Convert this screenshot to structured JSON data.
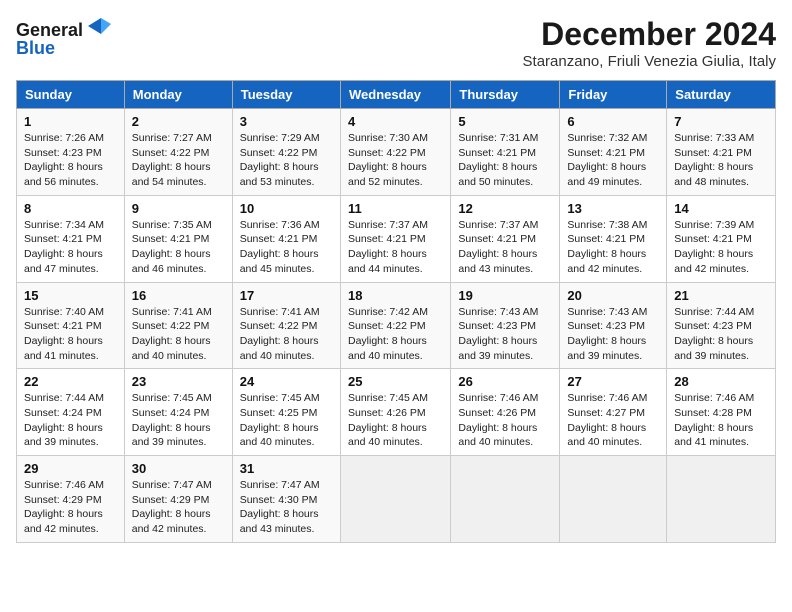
{
  "header": {
    "logo_line1": "General",
    "logo_line2": "Blue",
    "month_title": "December 2024",
    "subtitle": "Staranzano, Friuli Venezia Giulia, Italy"
  },
  "weekdays": [
    "Sunday",
    "Monday",
    "Tuesday",
    "Wednesday",
    "Thursday",
    "Friday",
    "Saturday"
  ],
  "weeks": [
    [
      {
        "day": "1",
        "sunrise": "7:26 AM",
        "sunset": "4:23 PM",
        "daylight": "8 hours and 56 minutes."
      },
      {
        "day": "2",
        "sunrise": "7:27 AM",
        "sunset": "4:22 PM",
        "daylight": "8 hours and 54 minutes."
      },
      {
        "day": "3",
        "sunrise": "7:29 AM",
        "sunset": "4:22 PM",
        "daylight": "8 hours and 53 minutes."
      },
      {
        "day": "4",
        "sunrise": "7:30 AM",
        "sunset": "4:22 PM",
        "daylight": "8 hours and 52 minutes."
      },
      {
        "day": "5",
        "sunrise": "7:31 AM",
        "sunset": "4:21 PM",
        "daylight": "8 hours and 50 minutes."
      },
      {
        "day": "6",
        "sunrise": "7:32 AM",
        "sunset": "4:21 PM",
        "daylight": "8 hours and 49 minutes."
      },
      {
        "day": "7",
        "sunrise": "7:33 AM",
        "sunset": "4:21 PM",
        "daylight": "8 hours and 48 minutes."
      }
    ],
    [
      {
        "day": "8",
        "sunrise": "7:34 AM",
        "sunset": "4:21 PM",
        "daylight": "8 hours and 47 minutes."
      },
      {
        "day": "9",
        "sunrise": "7:35 AM",
        "sunset": "4:21 PM",
        "daylight": "8 hours and 46 minutes."
      },
      {
        "day": "10",
        "sunrise": "7:36 AM",
        "sunset": "4:21 PM",
        "daylight": "8 hours and 45 minutes."
      },
      {
        "day": "11",
        "sunrise": "7:37 AM",
        "sunset": "4:21 PM",
        "daylight": "8 hours and 44 minutes."
      },
      {
        "day": "12",
        "sunrise": "7:37 AM",
        "sunset": "4:21 PM",
        "daylight": "8 hours and 43 minutes."
      },
      {
        "day": "13",
        "sunrise": "7:38 AM",
        "sunset": "4:21 PM",
        "daylight": "8 hours and 42 minutes."
      },
      {
        "day": "14",
        "sunrise": "7:39 AM",
        "sunset": "4:21 PM",
        "daylight": "8 hours and 42 minutes."
      }
    ],
    [
      {
        "day": "15",
        "sunrise": "7:40 AM",
        "sunset": "4:21 PM",
        "daylight": "8 hours and 41 minutes."
      },
      {
        "day": "16",
        "sunrise": "7:41 AM",
        "sunset": "4:22 PM",
        "daylight": "8 hours and 40 minutes."
      },
      {
        "day": "17",
        "sunrise": "7:41 AM",
        "sunset": "4:22 PM",
        "daylight": "8 hours and 40 minutes."
      },
      {
        "day": "18",
        "sunrise": "7:42 AM",
        "sunset": "4:22 PM",
        "daylight": "8 hours and 40 minutes."
      },
      {
        "day": "19",
        "sunrise": "7:43 AM",
        "sunset": "4:23 PM",
        "daylight": "8 hours and 39 minutes."
      },
      {
        "day": "20",
        "sunrise": "7:43 AM",
        "sunset": "4:23 PM",
        "daylight": "8 hours and 39 minutes."
      },
      {
        "day": "21",
        "sunrise": "7:44 AM",
        "sunset": "4:23 PM",
        "daylight": "8 hours and 39 minutes."
      }
    ],
    [
      {
        "day": "22",
        "sunrise": "7:44 AM",
        "sunset": "4:24 PM",
        "daylight": "8 hours and 39 minutes."
      },
      {
        "day": "23",
        "sunrise": "7:45 AM",
        "sunset": "4:24 PM",
        "daylight": "8 hours and 39 minutes."
      },
      {
        "day": "24",
        "sunrise": "7:45 AM",
        "sunset": "4:25 PM",
        "daylight": "8 hours and 40 minutes."
      },
      {
        "day": "25",
        "sunrise": "7:45 AM",
        "sunset": "4:26 PM",
        "daylight": "8 hours and 40 minutes."
      },
      {
        "day": "26",
        "sunrise": "7:46 AM",
        "sunset": "4:26 PM",
        "daylight": "8 hours and 40 minutes."
      },
      {
        "day": "27",
        "sunrise": "7:46 AM",
        "sunset": "4:27 PM",
        "daylight": "8 hours and 40 minutes."
      },
      {
        "day": "28",
        "sunrise": "7:46 AM",
        "sunset": "4:28 PM",
        "daylight": "8 hours and 41 minutes."
      }
    ],
    [
      {
        "day": "29",
        "sunrise": "7:46 AM",
        "sunset": "4:29 PM",
        "daylight": "8 hours and 42 minutes."
      },
      {
        "day": "30",
        "sunrise": "7:47 AM",
        "sunset": "4:29 PM",
        "daylight": "8 hours and 42 minutes."
      },
      {
        "day": "31",
        "sunrise": "7:47 AM",
        "sunset": "4:30 PM",
        "daylight": "8 hours and 43 minutes."
      },
      null,
      null,
      null,
      null
    ]
  ]
}
